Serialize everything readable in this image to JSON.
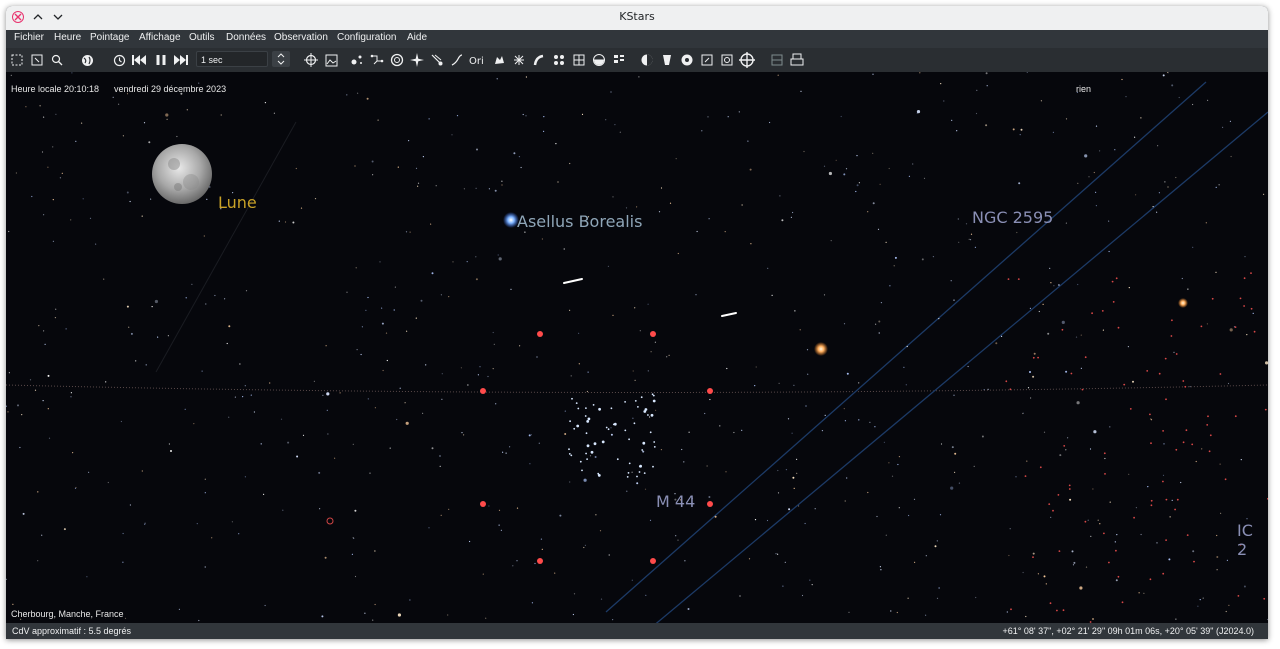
{
  "window": {
    "title": "KStars"
  },
  "menu": [
    "Fichier",
    "Heure",
    "Pointage",
    "Affichage",
    "Outils",
    "Données",
    "Observation",
    "Configuration",
    "Aide"
  ],
  "toolbar": {
    "time_step": "1 sec",
    "icons": [
      "zoom-box-icon",
      "zoom-fit-icon",
      "search-icon",
      "globe-icon",
      "clock-icon",
      "skip-back-icon",
      "pause-icon",
      "skip-forward-icon"
    ],
    "right_icons": [
      "crosshair-target-icon",
      "image-icon",
      "stars-icon",
      "constellation-lines-icon",
      "nebula-icon",
      "star-icon",
      "comet-icon",
      "asteroid-icon",
      "constellation-names-icon",
      "galaxy-icon",
      "supernova-icon",
      "milky-way-icon",
      "horizon-icon",
      "ground-icon",
      "grid-icon",
      "moon-phase-icon",
      "telescope-icon",
      "eye-icon",
      "observing-list-icon",
      "fov-icon",
      "target-icon",
      "mosaic-icon",
      "hips-icon"
    ]
  },
  "sky": {
    "local_time": "Heure locale 20:10:18",
    "date": "vendredi 29 décembre 2023",
    "focus_object": "rien",
    "location": "Cherbourg, Manche, France",
    "labels": {
      "moon": "Lune",
      "star": "Asellus Borealis",
      "ngc": "NGC 2595",
      "messier": "M 44",
      "ic": "IC 2"
    }
  },
  "status": {
    "fov": "CdV approximatif : 5.5 degrés",
    "coordinates": "+61° 08' 37\", +02° 21' 29\"  09h 01m 06s, +20° 05' 39\" (J2024.0)"
  },
  "colors": {
    "moon_label": "#c9a227",
    "star_label": "#8fa6b8",
    "deep_sky_label": "#8a8fb5",
    "marker": "#ff4b4b"
  }
}
